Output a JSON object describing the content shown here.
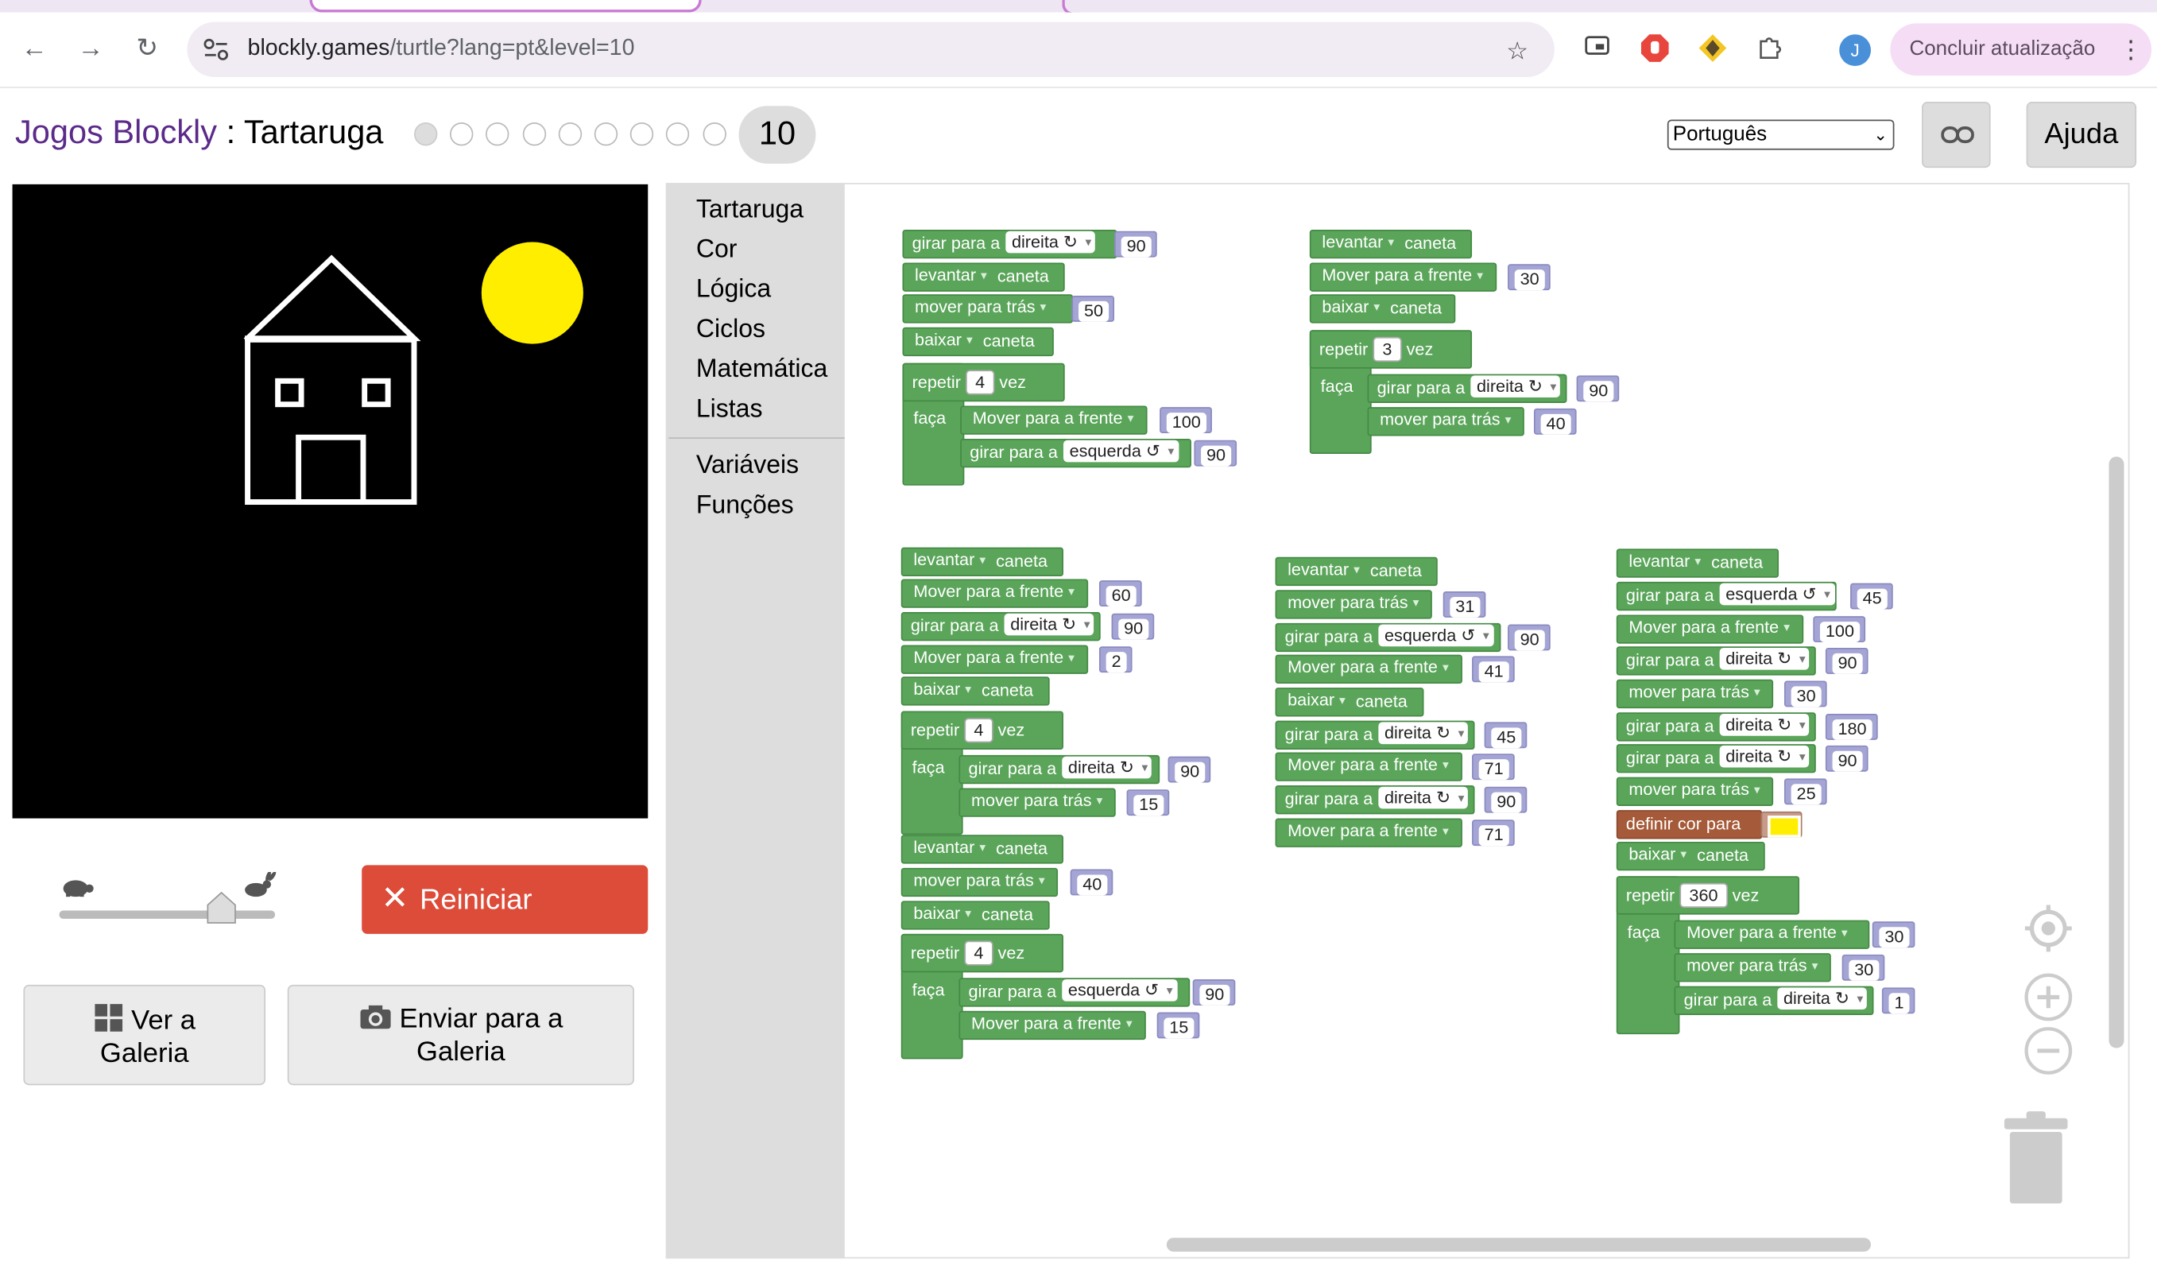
{
  "browser": {
    "url_host": "blockly.games",
    "url_path": "/turtle?lang=pt&level=10",
    "update_label": "Concluir atualização",
    "profile_initial": "J"
  },
  "header": {
    "app_link": "Jogos Blockly",
    "separator": " : ",
    "page_title": "Tartaruga",
    "current_level": "10",
    "total_levels": 10,
    "language": "Português",
    "help_label": "Ajuda"
  },
  "controls": {
    "reset_label": "Reiniciar",
    "gallery_view_label": [
      "Ver a",
      "Galeria"
    ],
    "gallery_submit_label": [
      "Enviar para a",
      "Galeria"
    ],
    "speed_level": 0.75
  },
  "toolbox": {
    "categories": [
      "Tartaruga",
      "Cor",
      "Lógica",
      "Ciclos",
      "Matemática",
      "Listas"
    ],
    "categories2": [
      "Variáveis",
      "Funções"
    ]
  },
  "colors": {
    "block_green": "#5ba55b",
    "block_brown": "#a55b39",
    "sun_yellow": "#ffee00",
    "reset_red": "#dd4b39"
  },
  "text": {
    "turn": "girar para a",
    "right": "direita ↻",
    "left": "esquerda ↺",
    "pen_up": "levantar",
    "pen_down": "baixar",
    "pen": "caneta",
    "forward": "Mover para a frente",
    "backward": "mover para trás",
    "repeat": "repetir",
    "times": "vez",
    "do": "faça",
    "set_color": "definir cor para"
  },
  "program": {
    "g1": [
      "90",
      "50",
      "4",
      "100",
      "90"
    ],
    "g2": [
      "30",
      "3",
      "90",
      "40"
    ],
    "g3": [
      "60",
      "90",
      "2",
      "4",
      "90",
      "15",
      "40",
      "4",
      "90",
      "15"
    ],
    "g4": [
      "31",
      "90",
      "41",
      "45",
      "71",
      "90",
      "71"
    ],
    "g5": [
      "45",
      "100",
      "90",
      "30",
      "180",
      "90",
      "25",
      "360",
      "30",
      "30",
      "1"
    ]
  }
}
